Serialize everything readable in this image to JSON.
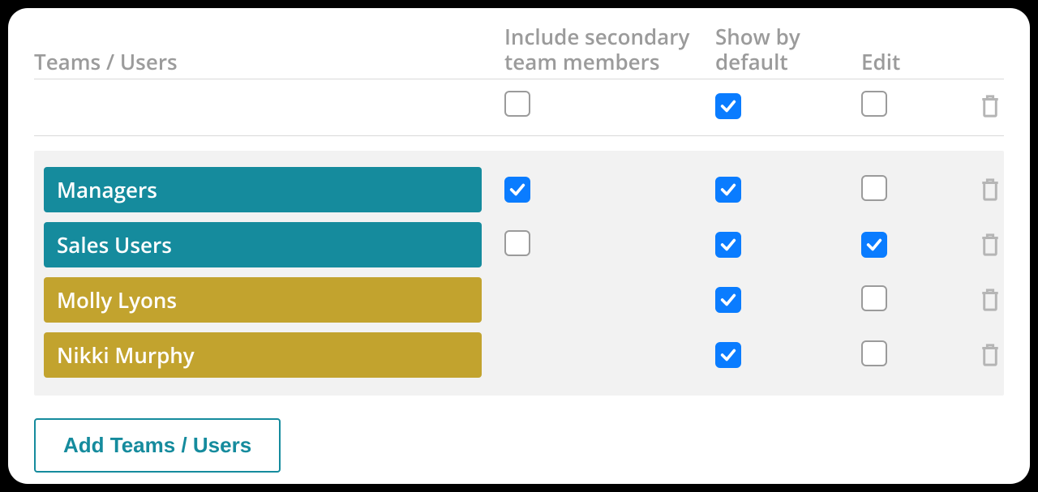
{
  "headers": {
    "name": "Teams / Users",
    "secondary": "Include secondary team members",
    "show": "Show by default",
    "edit": "Edit"
  },
  "allRow": {
    "include_secondary": false,
    "show_default": true,
    "edit": false
  },
  "rows": [
    {
      "label": "Managers",
      "kind": "team",
      "include_secondary": true,
      "show_default": true,
      "edit": false
    },
    {
      "label": "Sales Users",
      "kind": "team",
      "include_secondary": false,
      "show_default": true,
      "edit": true
    },
    {
      "label": "Molly Lyons",
      "kind": "user",
      "include_secondary": null,
      "show_default": true,
      "edit": false
    },
    {
      "label": "Nikki Murphy",
      "kind": "user",
      "include_secondary": null,
      "show_default": true,
      "edit": false
    }
  ],
  "buttons": {
    "add": "Add Teams / Users"
  },
  "colors": {
    "team_chip": "#158b9d",
    "user_chip": "#c2a32e",
    "checkbox_checked": "#0a7cff"
  }
}
